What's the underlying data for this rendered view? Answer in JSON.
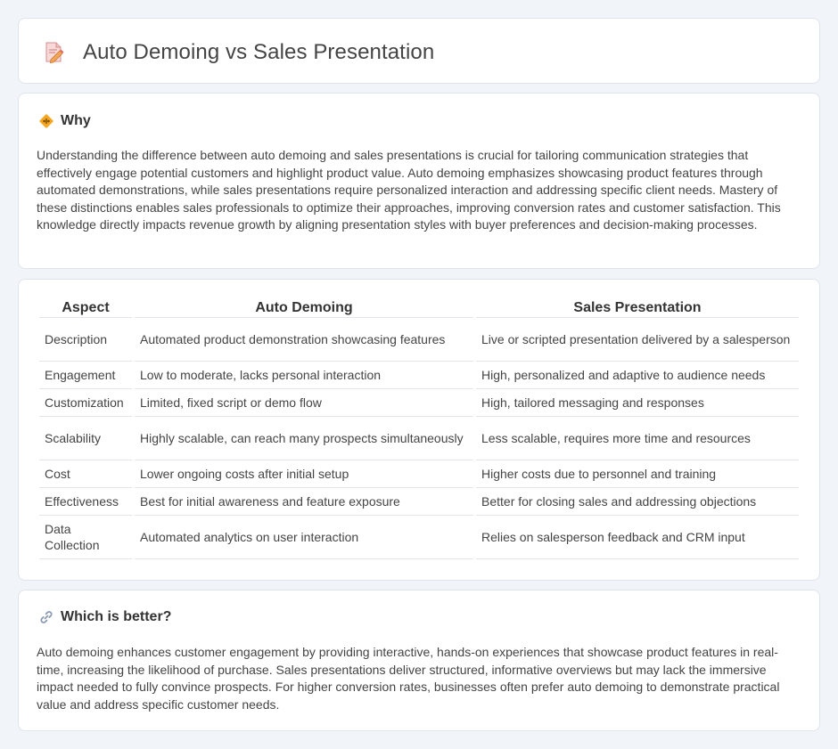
{
  "header": {
    "title": "Auto Demoing vs Sales Presentation",
    "icon": "document-edit-icon"
  },
  "why": {
    "heading": "Why",
    "icon": "diamond-sign-icon",
    "text": "Understanding the difference between auto demoing and sales presentations is crucial for tailoring communication strategies that effectively engage potential customers and highlight product value. Auto demoing emphasizes showcasing product features through automated demonstrations, while sales presentations require personalized interaction and addressing specific client needs. Mastery of these distinctions enables sales professionals to optimize their approaches, improving conversion rates and customer satisfaction. This knowledge directly impacts revenue growth by aligning presentation styles with buyer preferences and decision-making processes."
  },
  "table": {
    "headers": [
      "Aspect",
      "Auto Demoing",
      "Sales Presentation"
    ],
    "rows": [
      [
        "Description",
        "Automated product demonstration showcasing features",
        "Live or scripted presentation delivered by a salesperson"
      ],
      [
        "Engagement",
        "Low to moderate, lacks personal interaction",
        "High, personalized and adaptive to audience needs"
      ],
      [
        "Customization",
        "Limited, fixed script or demo flow",
        "High, tailored messaging and responses"
      ],
      [
        "Scalability",
        "Highly scalable, can reach many prospects simultaneously",
        "Less scalable, requires more time and resources"
      ],
      [
        "Cost",
        "Lower ongoing costs after initial setup",
        "Higher costs due to personnel and training"
      ],
      [
        "Effectiveness",
        "Best for initial awareness and feature exposure",
        "Better for closing sales and addressing objections"
      ],
      [
        "Data Collection",
        "Automated analytics on user interaction",
        "Relies on salesperson feedback and CRM input"
      ]
    ]
  },
  "better": {
    "heading": "Which is better?",
    "icon": "link-icon",
    "text": "Auto demoing enhances customer engagement by providing interactive, hands-on experiences that showcase product features in real-time, increasing the likelihood of purchase. Sales presentations deliver structured, informative overviews but may lack the immersive impact needed to fully convince prospects. For higher conversion rates, businesses often prefer auto demoing to demonstrate practical value and address specific customer needs."
  }
}
